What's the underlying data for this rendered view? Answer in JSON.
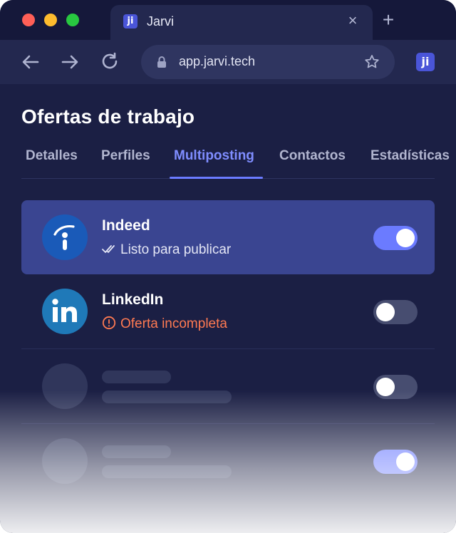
{
  "browser": {
    "tab_title": "Jarvi",
    "favicon_text": "ji",
    "url": "app.jarvi.tech",
    "extension_text": "ji"
  },
  "page": {
    "title": "Ofertas de trabajo",
    "tabs": [
      {
        "label": "Detalles",
        "active": false
      },
      {
        "label": "Perfiles",
        "active": false
      },
      {
        "label": "Multiposting",
        "active": true
      },
      {
        "label": "Contactos",
        "active": false
      },
      {
        "label": "Estadísticas",
        "active": false
      }
    ]
  },
  "job_boards": [
    {
      "name": "Indeed",
      "status": "Listo para publicar",
      "status_type": "ok",
      "enabled": true,
      "selected": true,
      "icon": "indeed-logo"
    },
    {
      "name": "LinkedIn",
      "status": "Oferta incompleta",
      "status_type": "warning",
      "enabled": false,
      "selected": false,
      "icon": "linkedin-logo"
    },
    {
      "placeholder": true,
      "enabled": false
    },
    {
      "placeholder": true,
      "enabled": true
    }
  ],
  "colors": {
    "accent": "#6b7bff",
    "background": "#1b1f44",
    "selected_row": "#3a4591",
    "warning": "#ff7a52",
    "indeed_blue": "#1a5ab8",
    "linkedin_blue": "#1f79b8"
  }
}
